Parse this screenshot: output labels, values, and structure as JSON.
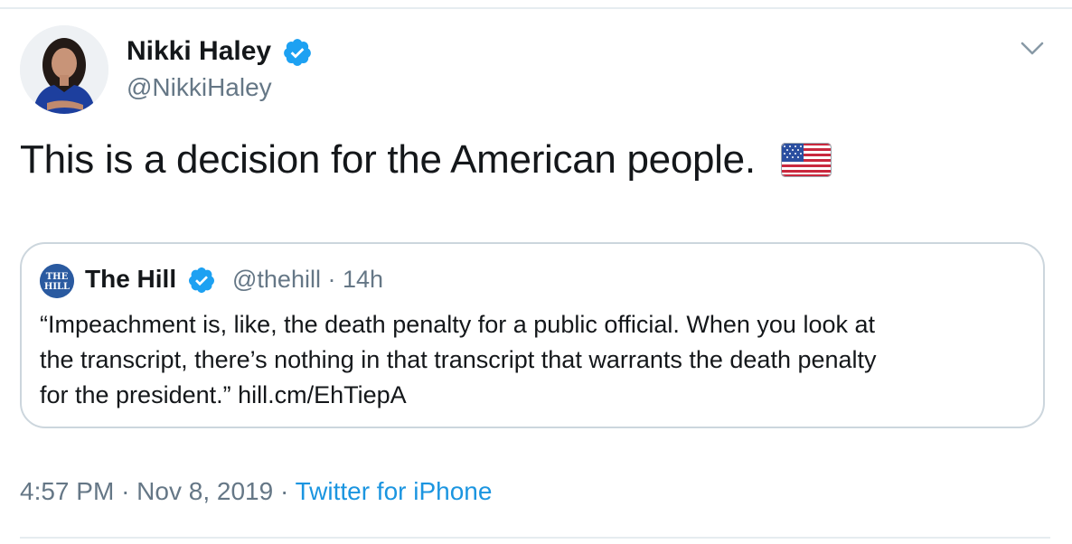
{
  "author": {
    "name": "Nikki Haley",
    "handle": "@NikkiHaley",
    "verified": true
  },
  "tweet": {
    "text": "This is a decision for the American people.",
    "emoji": "us-flag"
  },
  "quoted_tweet": {
    "name": "The Hill",
    "handle": "@thehill",
    "separator": "·",
    "age": "14h",
    "logo_text": "THE HILL",
    "body_lines": [
      "“Impeachment is, like, the death penalty for a public official. When you look at",
      "the transcript, there’s nothing in that transcript that warrants the death penalty",
      "for the president.” hill.cm/EhTiepA"
    ]
  },
  "footer": {
    "time": "4:57 PM",
    "sep1": "·",
    "date": "Nov 8, 2019",
    "sep2": "·",
    "source": "Twitter for iPhone"
  },
  "colors": {
    "verified_blue": "#1da1f2",
    "link_blue": "#1b95e0",
    "secondary_text": "#657786",
    "border": "#ccd6dd"
  }
}
